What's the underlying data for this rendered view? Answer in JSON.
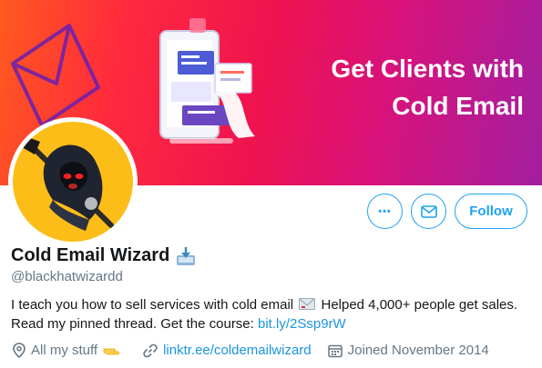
{
  "banner": {
    "headline_line1": "Get Clients with",
    "headline_line2": "Cold Email"
  },
  "profile": {
    "display_name": "Cold Email Wizard",
    "name_emoji": "inbox-tray-icon",
    "handle": "@blackhatwizardd",
    "bio_part1": "I teach you how to sell services with cold email",
    "bio_part2": "Helped 4,000+ people get sales.",
    "bio_part3": "Read my pinned thread. Get the course:",
    "bio_link": "bit.ly/2Ssp9rW",
    "location": "All my stuff",
    "website": "linktr.ee/coldemailwizard",
    "joined": "Joined November 2014"
  },
  "actions": {
    "more_label": "•••",
    "follow_label": "Follow"
  },
  "colors": {
    "accent": "#1da1f2",
    "link": "#1b95e0",
    "avatar_bg": "#fcbd18",
    "secondary_text": "#657786"
  }
}
